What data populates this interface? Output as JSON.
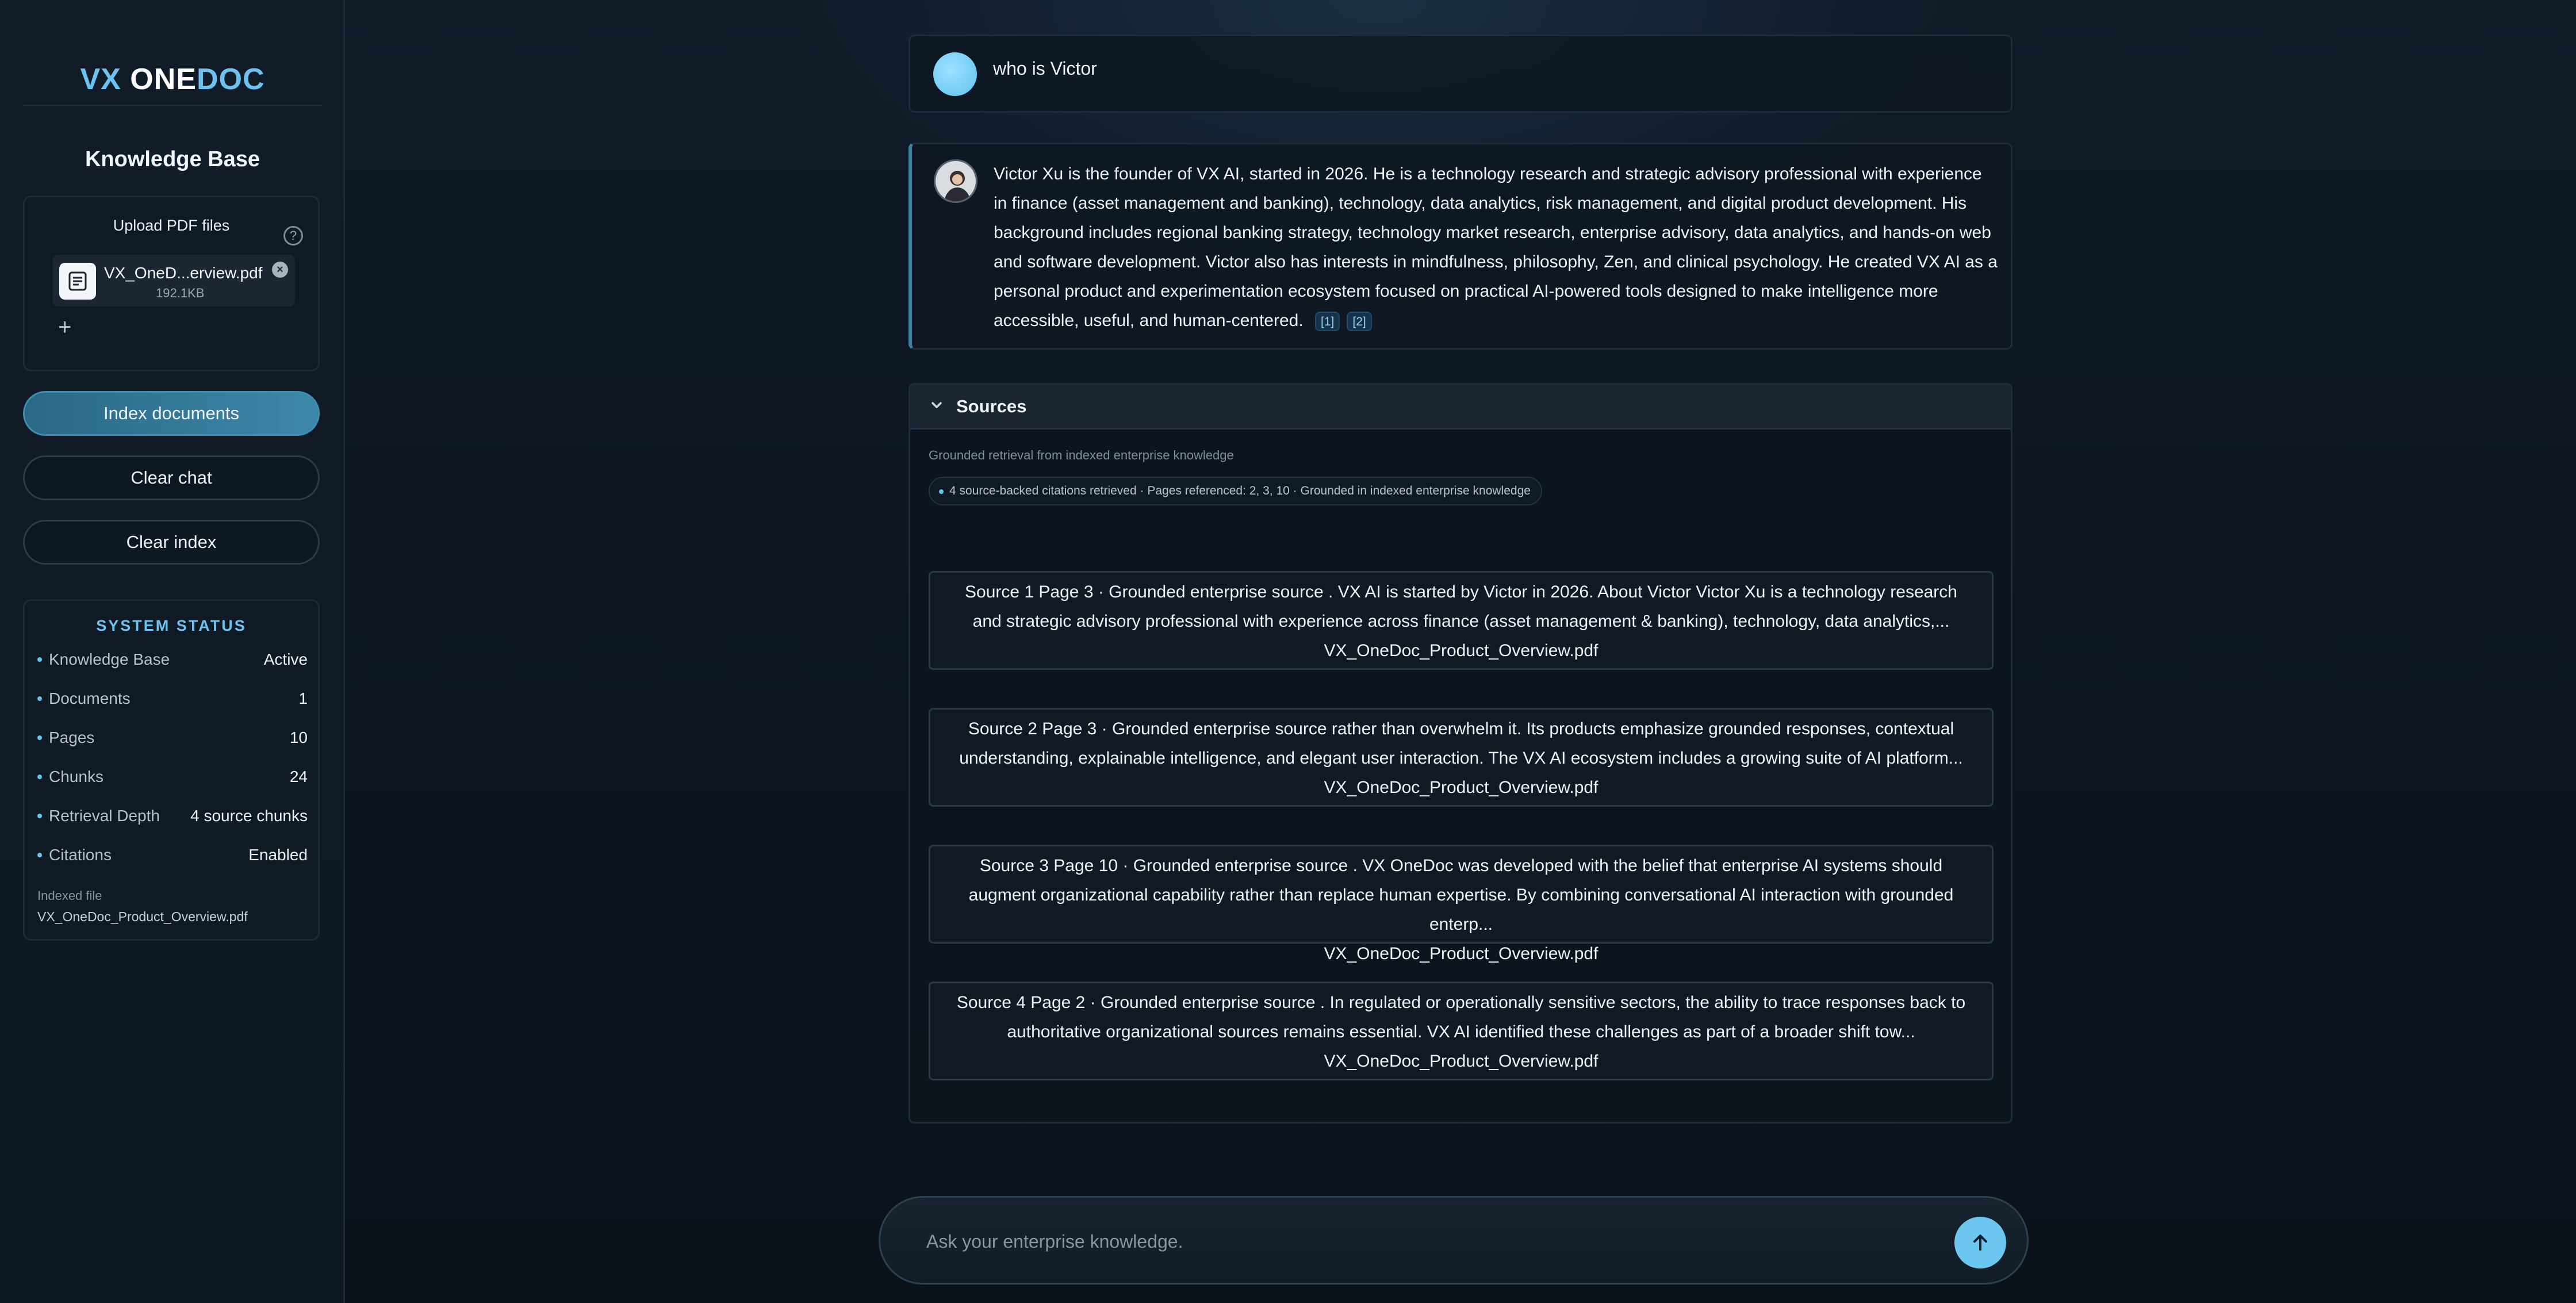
{
  "brand": {
    "vx": "VX",
    "one": "ONE",
    "doc": "DOC"
  },
  "sidebar": {
    "kb_title": "Knowledge Base",
    "upload_label": "Upload PDF files",
    "help_icon": "?",
    "file": {
      "name": "VX_OneD...erview.pdf",
      "size": "192.1KB"
    },
    "remove_icon": "×",
    "add_icon": "+",
    "buttons": {
      "index": "Index documents",
      "clear_chat": "Clear chat",
      "clear_index": "Clear index"
    },
    "status": {
      "title": "SYSTEM STATUS",
      "rows": [
        {
          "key": "Knowledge Base",
          "value": "Active"
        },
        {
          "key": "Documents",
          "value": "1"
        },
        {
          "key": "Pages",
          "value": "10"
        },
        {
          "key": "Chunks",
          "value": "24"
        },
        {
          "key": "Retrieval Depth",
          "value": "4 source chunks"
        },
        {
          "key": "Citations",
          "value": "Enabled"
        }
      ],
      "indexed_label": "Indexed file",
      "indexed_file": "VX_OneDoc_Product_Overview.pdf"
    }
  },
  "chat": {
    "user_message": "who is Victor",
    "answer": "Victor Xu is the founder of VX AI, started in 2026. He is a technology research and strategic advisory professional with experience in finance (asset management and banking), technology, data analytics, risk management, and digital product development. His background includes regional banking strategy, technology market research, enterprise advisory, data analytics, and hands-on web and software development. Victor also has interests in mindfulness, philosophy, Zen, and clinical psychology. He created VX AI as a personal product and experimentation ecosystem focused on practical AI-powered tools designed to make intelligence more accessible, useful, and human-centered.",
    "citations": [
      "[1]",
      "[2]"
    ]
  },
  "sources": {
    "title": "Sources",
    "subtitle": "Grounded retrieval from indexed enterprise knowledge",
    "summary": "4 source-backed citations retrieved · Pages referenced: 2, 3, 10 · Grounded in indexed enterprise knowledge",
    "items": [
      {
        "text": "Source 1 Page 3 · Grounded enterprise source . VX AI is started by Victor in 2026. About Victor Victor Xu is a technology research and strategic advisory professional with experience across finance (asset management & banking), technology, data analytics,...",
        "file": "VX_OneDoc_Product_Overview.pdf"
      },
      {
        "text": "Source 2 Page 3 · Grounded enterprise source rather than overwhelm it. Its products emphasize grounded responses, contextual understanding, explainable intelligence, and elegant user interaction. The VX AI ecosystem includes a growing suite of AI platform...",
        "file": "VX_OneDoc_Product_Overview.pdf"
      },
      {
        "text": "Source 3 Page 10 · Grounded enterprise source . VX OneDoc was developed with the belief that enterprise AI systems should augment organizational capability rather than replace human expertise. By combining conversational AI interaction with grounded enterp...",
        "file": "VX_OneDoc_Product_Overview.pdf"
      },
      {
        "text": "Source 4 Page 2 · Grounded enterprise source . In regulated or operationally sensitive sectors, the ability to trace responses back to authoritative organizational sources remains essential. VX AI identified these challenges as part of a broader shift tow...",
        "file": "VX_OneDoc_Product_Overview.pdf"
      }
    ]
  },
  "composer": {
    "placeholder": "Ask your enterprise knowledge."
  },
  "colors": {
    "accent": "#6cc3ef",
    "primary_button": "#3d88a8",
    "background": "#0d1621"
  },
  "icons": {
    "help": "help-icon",
    "file": "document-icon",
    "remove": "close-circle-icon",
    "add": "plus-icon",
    "chevron": "chevron-down-icon",
    "send": "arrow-up-icon"
  }
}
